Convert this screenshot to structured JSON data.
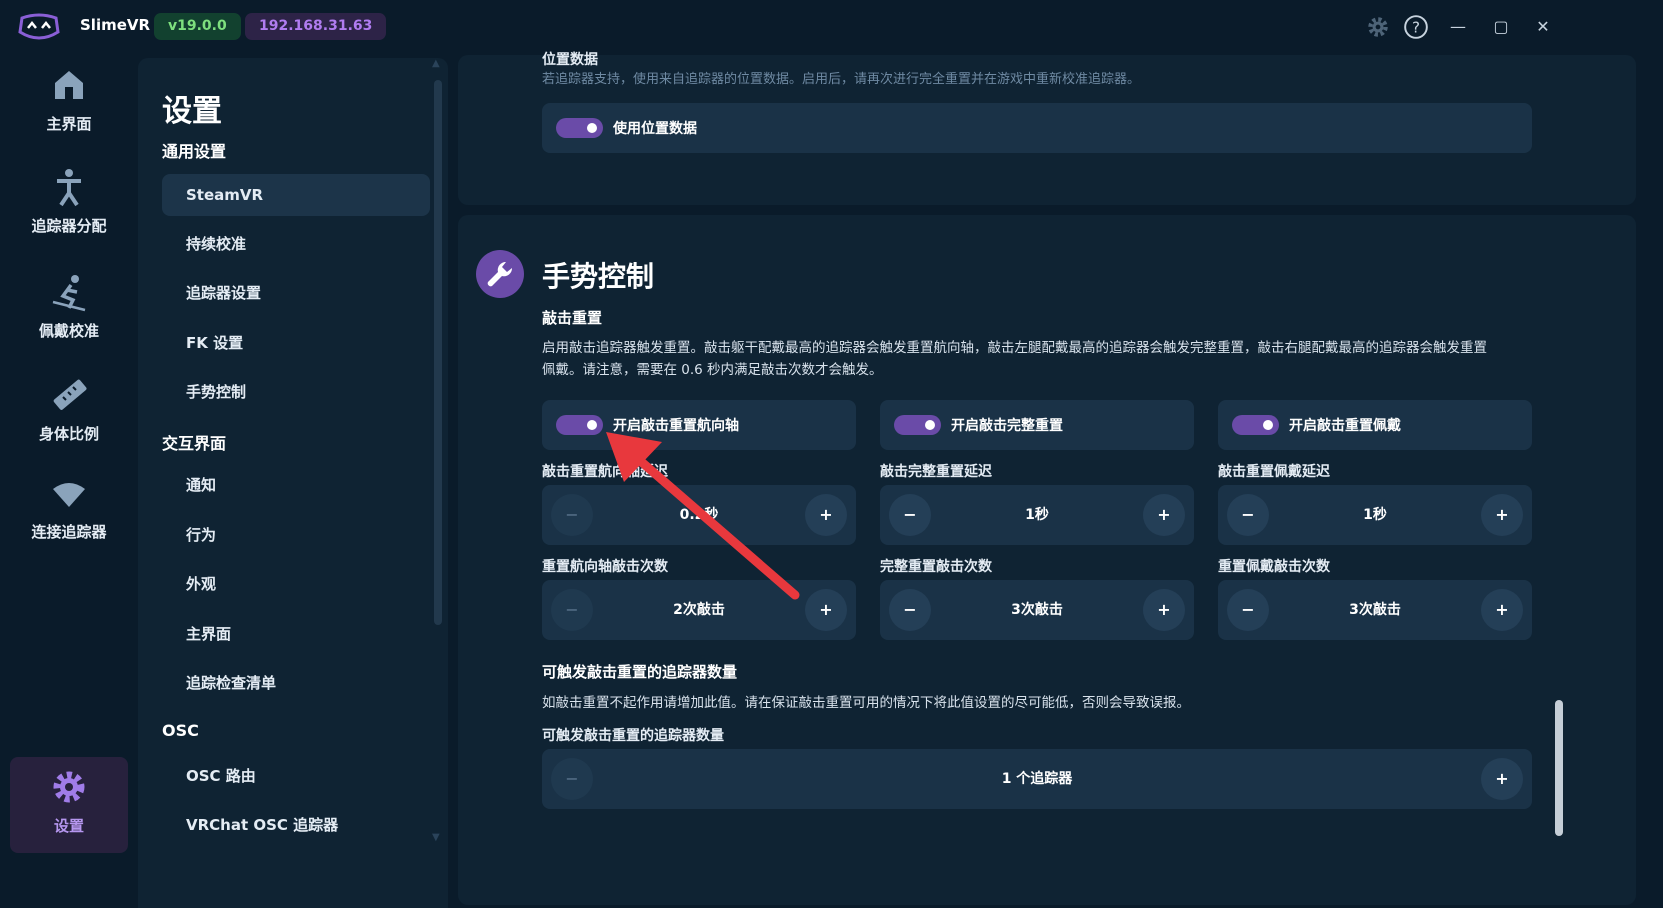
{
  "titlebar": {
    "app_name": "SlimeVR",
    "version": "v19.0.0",
    "ip": "192.168.31.63",
    "colors": {
      "version_bg": "#12412f",
      "version_fg": "#7ee07e",
      "ip_bg": "#2d2347",
      "ip_fg": "#b07cf0"
    }
  },
  "nav": {
    "items": [
      {
        "label": "主界面",
        "icon": "home-icon"
      },
      {
        "label": "追踪器分配",
        "icon": "person-icon"
      },
      {
        "label": "佩戴校准",
        "icon": "skier-icon"
      },
      {
        "label": "身体比例",
        "icon": "ruler-icon"
      },
      {
        "label": "连接追踪器",
        "icon": "wifi-icon"
      },
      {
        "label": "设置",
        "icon": "gear-icon"
      }
    ]
  },
  "sidebar": {
    "title": "设置",
    "sections": [
      {
        "title": "通用设置",
        "items": [
          "SteamVR",
          "持续校准",
          "追踪器设置",
          "FK 设置",
          "手势控制"
        ]
      },
      {
        "title": "交互界面",
        "items": [
          "通知",
          "行为",
          "外观",
          "主界面",
          "追踪检查清单"
        ]
      },
      {
        "title": "OSC",
        "items": [
          "OSC 路由",
          "VRChat OSC 追踪器"
        ]
      }
    ]
  },
  "position_data": {
    "title": "位置数据",
    "description": "若追踪器支持，使用来自追踪器的位置数据。启用后，请再次进行完全重置并在游戏中重新校准追踪器。",
    "toggle_label": "使用位置数据"
  },
  "gesture": {
    "title": "手势控制",
    "tap_reset_title": "敲击重置",
    "tap_reset_desc_1": "启用敲击追踪器触发重置。敲击躯干配戴最高的追踪器会触发重置航向轴，敲击左腿配戴最高的追踪器会触发完整重置，敲击右腿配戴最高的追踪器会触发重置",
    "tap_reset_desc_2": "佩戴。请注意，需要在 0.6 秒内满足敲击次数才会触发。",
    "toggles": [
      "开启敲击重置航向轴",
      "开启敲击完整重置",
      "开启敲击重置佩戴"
    ],
    "delay_labels": [
      "敲击重置航向轴延迟",
      "敲击完整重置延迟",
      "敲击重置佩戴延迟"
    ],
    "delay_values": [
      "0.2秒",
      "1秒",
      "1秒"
    ],
    "count_labels": [
      "重置航向轴敲击次数",
      "完整重置敲击次数",
      "重置佩戴敲击次数"
    ],
    "count_values": [
      "2次敲击",
      "3次敲击",
      "3次敲击"
    ],
    "tracker_count_title": "可触发敲击重置的追踪器数量",
    "tracker_count_desc": "如敲击重置不起作用请增加此值。请在保证敲击重置可用的情况下将此值设置的尽可能低，否则会导致误报。",
    "tracker_count_label": "可触发敲击重置的追踪器数量",
    "tracker_count_value": "1 个追踪器",
    "minus": "−",
    "plus": "+"
  }
}
